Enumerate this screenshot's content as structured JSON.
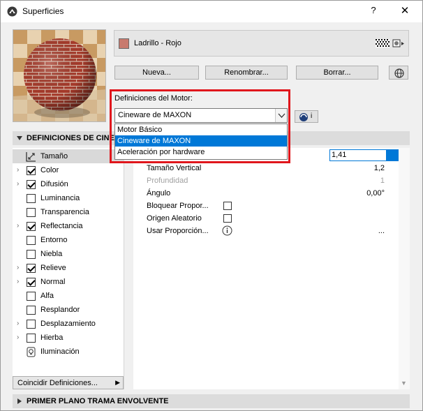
{
  "window": {
    "title": "Superficies",
    "help": "?",
    "close": "✕"
  },
  "surface": {
    "name": "Ladrillo - Rojo",
    "swatch_color": "#c87a6e"
  },
  "buttons": {
    "new": "Nueva...",
    "rename": "Renombrar...",
    "delete": "Borrar..."
  },
  "engine": {
    "label": "Definiciones del Motor:",
    "selected": "Cineware de MAXON",
    "info_label": "i",
    "options": [
      "Motor Básico",
      "Cineware de MAXON",
      "Aceleración por hardware"
    ],
    "highlighted_index": 1
  },
  "sections": {
    "cineware": "DEFINICIONES DE CINEWARE",
    "foreground": "PRIMER PLANO TRAMA ENVOLVENTE"
  },
  "channels": [
    {
      "label": "Tamaño",
      "type": "icon",
      "icon": "resize-icon",
      "expandable": false,
      "selected": true
    },
    {
      "label": "Color",
      "type": "check",
      "checked": true,
      "expandable": true
    },
    {
      "label": "Difusión",
      "type": "check",
      "checked": true,
      "expandable": true
    },
    {
      "label": "Luminancia",
      "type": "check",
      "checked": false,
      "expandable": false
    },
    {
      "label": "Transparencia",
      "type": "check",
      "checked": false,
      "expandable": false
    },
    {
      "label": "Reflectancia",
      "type": "check",
      "checked": true,
      "expandable": true
    },
    {
      "label": "Entorno",
      "type": "check",
      "checked": false,
      "expandable": false
    },
    {
      "label": "Niebla",
      "type": "check",
      "checked": false,
      "expandable": false
    },
    {
      "label": "Relieve",
      "type": "check",
      "checked": true,
      "expandable": true
    },
    {
      "label": "Normal",
      "type": "check",
      "checked": true,
      "expandable": true
    },
    {
      "label": "Alfa",
      "type": "check",
      "checked": false,
      "expandable": false
    },
    {
      "label": "Resplandor",
      "type": "check",
      "checked": false,
      "expandable": false
    },
    {
      "label": "Desplazamiento",
      "type": "check",
      "checked": false,
      "expandable": true
    },
    {
      "label": "Hierba",
      "type": "check",
      "checked": false,
      "expandable": true
    },
    {
      "label": "Iluminación",
      "type": "icon",
      "icon": "lightbulb-icon",
      "expandable": false
    }
  ],
  "match_button": {
    "label": "Coincidir Definiciones...",
    "arrow": "▶"
  },
  "params": {
    "width_value": "1,41",
    "rows": [
      {
        "label": "Tamaño Vertical",
        "value": "1,2",
        "disabled": false
      },
      {
        "label": "Profundidad",
        "value": "1",
        "disabled": true
      },
      {
        "label": "Ángulo",
        "value": "0,00°",
        "disabled": false
      },
      {
        "label": "Bloquear Propor...",
        "control": "checkbox"
      },
      {
        "label": "Origen Aleatorio",
        "control": "checkbox"
      },
      {
        "label": "Usar Proporción...",
        "control": "info",
        "value": "..."
      }
    ]
  },
  "accent_colors": {
    "highlight_red": "#e0161c",
    "selection_blue": "#0078d7"
  }
}
